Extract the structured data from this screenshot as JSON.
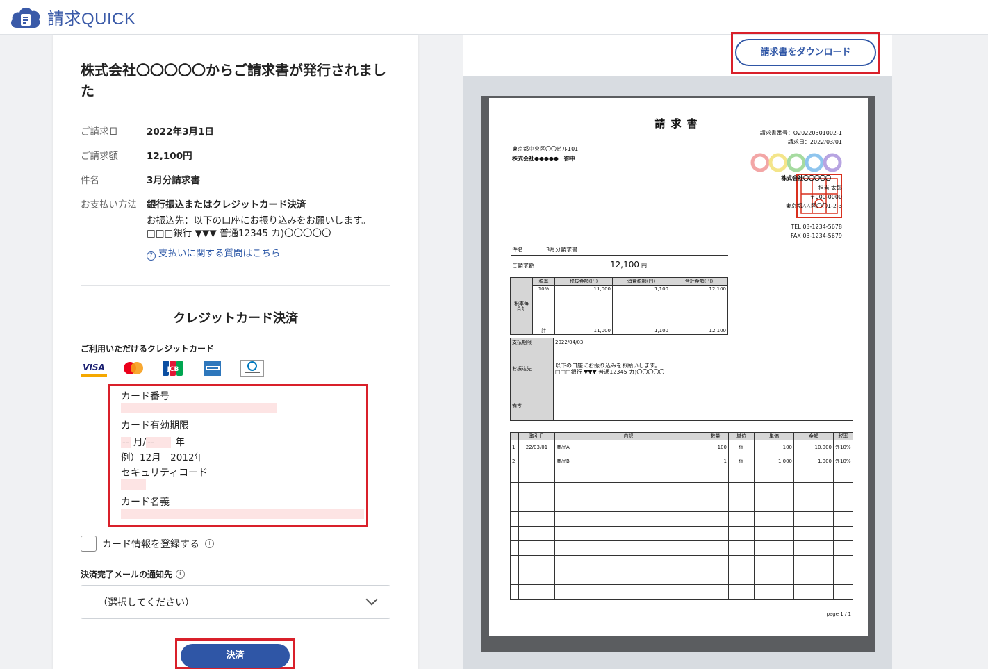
{
  "header": {
    "logo_text": "請求QUICK"
  },
  "left": {
    "title": "株式会社〇〇〇〇〇からご請求書が発行されました",
    "info": [
      {
        "key": "ご請求日",
        "value": "2022年3月1日"
      },
      {
        "key": "ご請求額",
        "value": "12,100円"
      },
      {
        "key": "件名",
        "value": "3月分請求書"
      },
      {
        "key": "お支払い方法",
        "value": "銀行振込またはクレジットカード決済"
      }
    ],
    "transfer_line1": "お振込先：以下の口座にお振り込みをお願いします。",
    "transfer_line2": "□□□銀行 ▼▼▼ 普通12345 カ)〇〇〇〇〇",
    "help_link": "支払いに関する質問はこちら",
    "cc_title": "クレジットカード決済",
    "cc_available": "ご利用いただけるクレジットカード",
    "brands": [
      "VISA",
      "mastercard",
      "JCB",
      "AMERICAN EXPRESS",
      "Diners Club"
    ],
    "card_number_label": "カード番号",
    "expiry_label": "カード有効期限",
    "expiry_month_ph": "--",
    "expiry_month_unit": "月/",
    "expiry_year_ph": "--",
    "expiry_year_unit": "年",
    "expiry_example": "例）12月　2012年",
    "security_code_label": "セキュリティコード",
    "card_name_label": "カード名義",
    "register_label": "カード情報を登録する",
    "mail_label": "決済完了メールの通知先",
    "select_value": "（選択してください）",
    "pay_button": "決済"
  },
  "right": {
    "download_button": "請求書をダウンロード",
    "invoice": {
      "title": "請求書",
      "number": "請求書番号：Q20220301002-1",
      "date": "請求日：2022/03/01",
      "addr": "東京都中央区〇〇ビル101",
      "to": "株式会社●●●●●　御中",
      "company": "株式会社〇〇〇〇〇",
      "person": "担当 太郎",
      "zip": "〒000-0000",
      "company_addr": "東京都△△区〇〇1-2-3",
      "tel": "TEL 03-1234-5678",
      "fax": "FAX 03-1234-5679",
      "subject_label": "件名",
      "subject": "3月分請求書",
      "amount_label": "ご請求額",
      "amount": "12,100",
      "amount_unit": "円",
      "tax_headers": [
        "税率",
        "税抜金額(円)",
        "消費税額(円)",
        "合計金額(円)"
      ],
      "tax_side": "税率毎合計",
      "tax_row": [
        "10%",
        "11,000",
        "1,100",
        "12,100"
      ],
      "tax_total": [
        "計",
        "11,000",
        "1,100",
        "12,100"
      ],
      "due_label": "支払期限",
      "due": "2022/04/03",
      "bank_label": "お振込先",
      "bank_line1": "以下の口座にお振り込みをお願いします。",
      "bank_line2": "□□□銀行 ▼▼▼ 普通12345 カ)〇〇〇〇〇",
      "note_label": "備考",
      "item_headers": [
        "取引日",
        "内訳",
        "数量",
        "単位",
        "単価",
        "金額",
        "税率"
      ],
      "items": [
        [
          "1",
          "22/03/01",
          "商品A",
          "100",
          "個",
          "100",
          "10,000",
          "外10%"
        ],
        [
          "2",
          "",
          "商品B",
          "1",
          "個",
          "1,000",
          "1,000",
          "外10%"
        ]
      ],
      "page": "page 1 / 1"
    }
  },
  "colors": {
    "accent": "#2f56a6",
    "highlight": "#d9202a",
    "pink": "#fde4e4"
  }
}
